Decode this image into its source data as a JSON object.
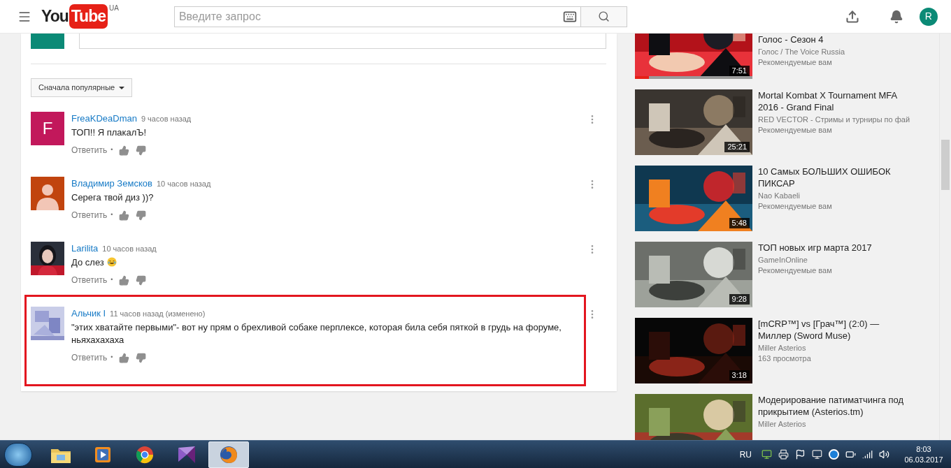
{
  "header": {
    "logo_you": "You",
    "logo_tube": "Tube",
    "region": "UA",
    "search": {
      "placeholder": "Введите запрос"
    },
    "account_initial": "R"
  },
  "sort_button": {
    "label": "Сначала популярные"
  },
  "comments": [
    {
      "author": "FreaKDeaDman",
      "time": "9 часов назад",
      "text": "ТОП!! Я плакалЪ!",
      "emoji": false,
      "reply": "Ответить",
      "separator": "•",
      "highlighted": false,
      "avatar": {
        "kind": "letter",
        "letter": "F",
        "color": "#c2185b"
      }
    },
    {
      "author": "Владимир Земсков",
      "time": "10 часов назад",
      "text": "Серега твой диз ))?",
      "emoji": false,
      "reply": "Ответить",
      "separator": "•",
      "highlighted": false,
      "avatar": {
        "kind": "silhouette",
        "color": "#c1440e"
      }
    },
    {
      "author": "Larilita",
      "time": "10 часов назад",
      "text": "До слез",
      "emoji": true,
      "reply": "Ответить",
      "separator": "•",
      "highlighted": false
    },
    {
      "author": "Альчик I",
      "time": "11 часов назад (изменено)",
      "text": "\"этих хватайте первыми\"- вот ну прям о брехливой собаке перплексе, которая била себя пяткой в грудь на форуме, ньяхахахаха",
      "emoji": false,
      "reply": "Ответить",
      "separator": "•",
      "highlighted": true
    }
  ],
  "videos": [
    {
      "title": "Голос - Сезон 4",
      "channel": "Голос / The Voice Russia",
      "meta": "Рекомендуемые вам",
      "duration": "7:51",
      "progress": {
        "level": 0.12
      }
    },
    {
      "title": "Mortal Kombat X Tournament MFA 2016 - Grand Final",
      "channel": "RED VECTOR - Стримы и турниры по фай",
      "meta": "Рекомендуемые вам",
      "duration": "25:21"
    },
    {
      "title": "10 Самых БОЛЬШИХ ОШИБОК ПИКСАР",
      "channel": "Nao Kabaeli",
      "meta": "Рекомендуемые вам",
      "duration": "5:48"
    },
    {
      "title": "ТОП новых игр марта 2017",
      "channel": "GameInOnline",
      "meta": "Рекомендуемые вам",
      "duration": "9:28"
    },
    {
      "title": "[mCRP™] vs [Грач™] (2:0) — Миллер (Sword Muse)",
      "channel": "Miller Asterios",
      "meta": "163 просмотра",
      "duration": "3:18"
    },
    {
      "title": "Модерирование патиматчинга под прикрытием (Asterios.tm)",
      "channel": "Miller Asterios"
    }
  ],
  "taskbar": {
    "apps": [
      {
        "kind": "folder",
        "selected": false
      },
      {
        "kind": "media",
        "selected": false
      },
      {
        "kind": "browser",
        "selected": false
      },
      {
        "kind": "studio",
        "selected": false
      },
      {
        "kind": "firefox",
        "selected": true
      }
    ],
    "language": "RU",
    "time": "8:03",
    "date": "06.03.2017"
  }
}
